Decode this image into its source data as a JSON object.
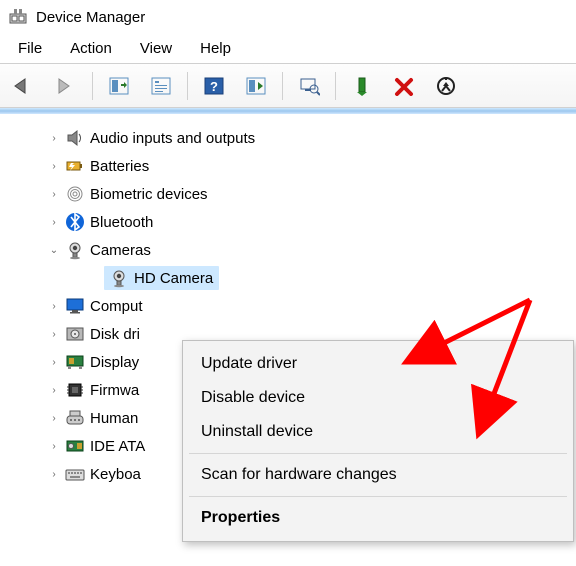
{
  "window": {
    "title": "Device Manager"
  },
  "menubar": [
    "File",
    "Action",
    "View",
    "Help"
  ],
  "tree": {
    "items": [
      {
        "label": "Audio inputs and outputs",
        "expanded": false,
        "icon": "speaker"
      },
      {
        "label": "Batteries",
        "expanded": false,
        "icon": "battery"
      },
      {
        "label": "Biometric devices",
        "expanded": false,
        "icon": "fingerprint"
      },
      {
        "label": "Bluetooth",
        "expanded": false,
        "icon": "bluetooth"
      },
      {
        "label": "Cameras",
        "expanded": true,
        "icon": "camera",
        "children": [
          {
            "label": "HD Camera",
            "icon": "camera",
            "selected": true
          }
        ]
      },
      {
        "label": "Comput",
        "expanded": false,
        "icon": "monitor"
      },
      {
        "label": "Disk dri",
        "expanded": false,
        "icon": "disk"
      },
      {
        "label": "Display",
        "expanded": false,
        "icon": "display-adapter"
      },
      {
        "label": "Firmwa",
        "expanded": false,
        "icon": "chip"
      },
      {
        "label": "Human",
        "expanded": false,
        "icon": "hid"
      },
      {
        "label": "IDE ATA",
        "expanded": false,
        "icon": "ide"
      },
      {
        "label": "Keyboa",
        "expanded": false,
        "icon": "keyboard"
      }
    ]
  },
  "context_menu": {
    "items": [
      {
        "label": "Update driver"
      },
      {
        "label": "Disable device"
      },
      {
        "label": "Uninstall device"
      },
      {
        "sep": true
      },
      {
        "label": "Scan for hardware changes"
      },
      {
        "sep": true
      },
      {
        "label": "Properties",
        "bold": true
      }
    ]
  }
}
